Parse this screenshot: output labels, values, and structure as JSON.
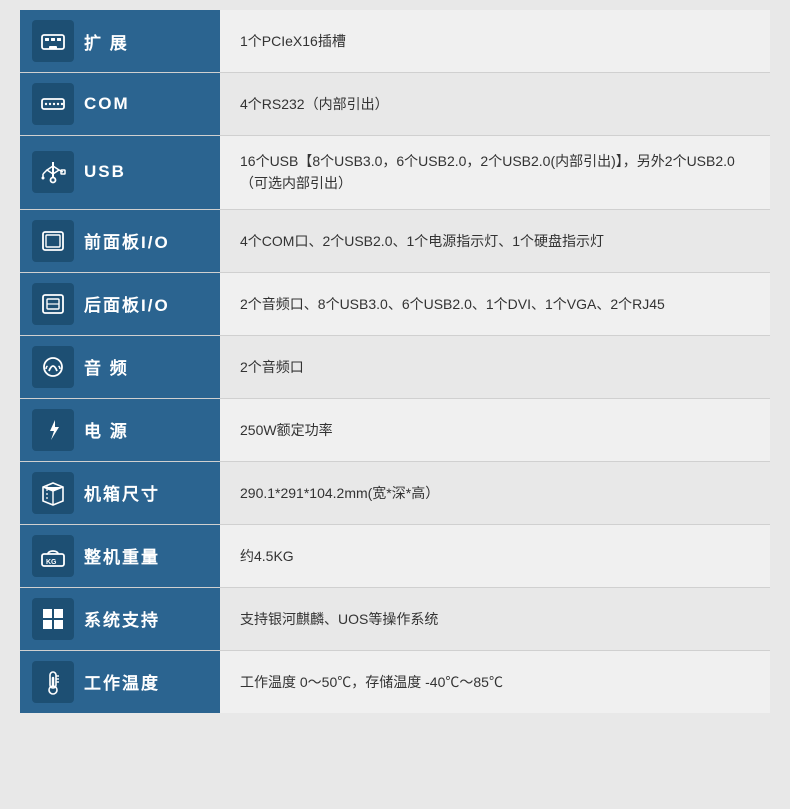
{
  "rows": [
    {
      "id": "expansion",
      "icon": "expansion",
      "label": "扩 展",
      "value": "1个PCIeX16插槽"
    },
    {
      "id": "com",
      "icon": "com",
      "label": "COM",
      "value": "4个RS232（内部引出）"
    },
    {
      "id": "usb",
      "icon": "usb",
      "label": "USB",
      "value": "16个USB【8个USB3.0，6个USB2.0，2个USB2.0(内部引出)】，另外2个USB2.0（可选内部引出）"
    },
    {
      "id": "front-io",
      "icon": "front-io",
      "label": "前面板I/O",
      "value": "4个COM口、2个USB2.0、1个电源指示灯、1个硬盘指示灯"
    },
    {
      "id": "rear-io",
      "icon": "rear-io",
      "label": "后面板I/O",
      "value": "2个音频口、8个USB3.0、6个USB2.0、1个DVI、1个VGA、2个RJ45"
    },
    {
      "id": "audio",
      "icon": "audio",
      "label": "音 频",
      "value": "2个音频口"
    },
    {
      "id": "power",
      "icon": "power",
      "label": "电 源",
      "value": "250W额定功率"
    },
    {
      "id": "chassis",
      "icon": "chassis",
      "label": "机箱尺寸",
      "value": "290.1*291*104.2mm(宽*深*高）"
    },
    {
      "id": "weight",
      "icon": "weight",
      "label": "整机重量",
      "value": "约4.5KG"
    },
    {
      "id": "os",
      "icon": "os",
      "label": "系统支持",
      "value": "支持银河麒麟、UOS等操作系统"
    },
    {
      "id": "temp",
      "icon": "temp",
      "label": "工作温度",
      "value": "工作温度 0～50℃，存储温度 -40℃～85℃"
    }
  ]
}
